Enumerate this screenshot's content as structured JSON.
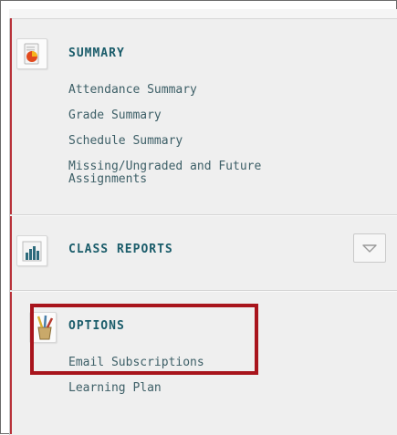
{
  "summary": {
    "title": "SUMMARY",
    "icon": "summary-pie-icon",
    "links": [
      "Attendance Summary",
      "Grade Summary",
      "Schedule Summary",
      "Missing/Ungraded and Future Assignments"
    ]
  },
  "class_reports": {
    "title": "CLASS REPORTS",
    "icon": "bar-chart-icon",
    "toggle_icon": "chevron-down-icon"
  },
  "options": {
    "title": "OPTIONS",
    "icon": "pencil-cup-icon",
    "links": [
      "Email Subscriptions",
      "Learning Plan"
    ]
  },
  "colors": {
    "heading": "#1a5c6a",
    "link": "#3d5f67",
    "highlight": "#a8141c",
    "panel": "#efefef"
  }
}
